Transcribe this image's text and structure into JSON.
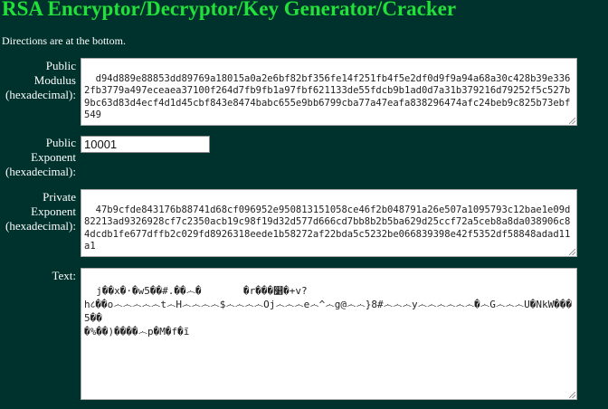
{
  "header": {
    "title": "RSA Encryptor/Decryptor/Key Generator/Cracker",
    "directions": "Directions are at the bottom."
  },
  "fields": {
    "modulus": {
      "label_1": "Public",
      "label_2": "Modulus",
      "label_3": "(hexadecimal):",
      "value": "d94d889e88853dd89769a18015a0a2e6bf82bf356fe14f251fb4f5e2df0d9f9a94a68a30c428b39e3362fb3779a497eceaea37100f264d7fb9fb1a97fbf621133de55fdcb9b1ad0d7a31b379216d79252f5c527b9bc63d83d4ecf4d1d45cbf843e8474babc655e9bb6799cba77a47eafa838296474afc24beb9c825b73ebf549"
    },
    "public_exponent": {
      "label_1": "Public",
      "label_2": "Exponent",
      "label_3": "(hexadecimal):",
      "value": "10001"
    },
    "private_exponent": {
      "label_1": "Private",
      "label_2": "Exponent",
      "label_3": "(hexadecimal):",
      "value": "47b9cfde843176b88741d68cf096952e950813151058ce46f2b048791a26e507a1095793c12bae1e09d82213ad9326928cf7c2350acb19c98f19d32d577d666cd7bb8b2b5ba629d25ccf72a5ceb8a8da038906c84dcdb1fe677dffb2c029fd8926318eede1b58272af22bda5c5232be066839398e42f5352df58848adad11a1"
    },
    "text": {
      "label": "Text:",
      "value": "j��x�·�w5��#.��෴�       �r���෸�+v?\nh८��o෴෴෴෴෴t෴H෴෴෴෴$෴෴෴෴Oj෴෴෴e෴^෴g@෴෴}8#෴෴෴y෴෴෴෴෴෴�෴G෴෴෴U�NkW���5��\n�%��)����෴p�M�f�ĩ"
    }
  }
}
